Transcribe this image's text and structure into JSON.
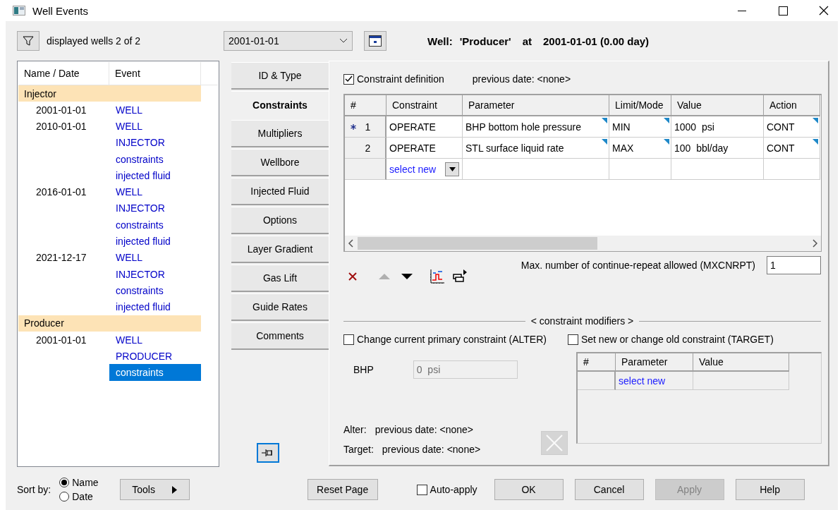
{
  "window": {
    "title": "Well Events"
  },
  "filter": {
    "label": "displayed wells 2 of 2"
  },
  "date_combo": {
    "value": "2001-01-01"
  },
  "well_header": {
    "label": "Well:",
    "name": "'Producer'",
    "at": "at",
    "date": "2001-01-01 (0.00 day)"
  },
  "tree": {
    "columns": [
      "Name / Date",
      "Event"
    ],
    "groups": [
      {
        "name": "Injector",
        "children": [
          {
            "date": "2001-01-01",
            "children": [
              {
                "event": "WELL",
                "selected": false
              }
            ]
          },
          {
            "date": "2010-01-01",
            "children": [
              {
                "event": "WELL",
                "selected": false
              },
              {
                "event": "INJECTOR",
                "selected": false
              },
              {
                "event": "constraints",
                "selected": false
              },
              {
                "event": "injected fluid",
                "selected": false
              }
            ]
          },
          {
            "date": "2016-01-01",
            "children": [
              {
                "event": "WELL",
                "selected": false
              },
              {
                "event": "INJECTOR",
                "selected": false
              },
              {
                "event": "constraints",
                "selected": false
              },
              {
                "event": "injected fluid",
                "selected": false
              }
            ]
          },
          {
            "date": "2021-12-17",
            "children": [
              {
                "event": "WELL",
                "selected": false
              },
              {
                "event": "INJECTOR",
                "selected": false
              },
              {
                "event": "constraints",
                "selected": false
              },
              {
                "event": "injected fluid",
                "selected": false
              }
            ]
          }
        ]
      },
      {
        "name": "Producer",
        "children": [
          {
            "date": "2001-01-01",
            "children": [
              {
                "event": "WELL",
                "selected": false
              },
              {
                "event": "PRODUCER",
                "selected": false
              },
              {
                "event": "constraints",
                "selected": true
              }
            ]
          }
        ]
      }
    ]
  },
  "tabs": [
    {
      "label": "ID & Type",
      "selected": false
    },
    {
      "label": "Constraints",
      "selected": true
    },
    {
      "label": "Multipliers",
      "selected": false
    },
    {
      "label": "Wellbore",
      "selected": false
    },
    {
      "label": "Injected Fluid",
      "selected": false
    },
    {
      "label": "Options",
      "selected": false
    },
    {
      "label": "Layer Gradient",
      "selected": false
    },
    {
      "label": "Gas Lift",
      "selected": false
    },
    {
      "label": "Guide Rates",
      "selected": false
    },
    {
      "label": "Comments",
      "selected": false
    }
  ],
  "constraints": {
    "definition": {
      "label": "Constraint definition",
      "checked": true
    },
    "previous_date": "previous date: <none>",
    "columns": [
      "#",
      "Constraint",
      "Parameter",
      "Limit/Mode",
      "Value",
      "Action"
    ],
    "rows": [
      {
        "current": true,
        "cells": [
          {
            "text": "1",
            "dropdown": false
          },
          {
            "text": "OPERATE",
            "dropdown": false
          },
          {
            "text": "BHP bottom hole pressure",
            "dropdown": true
          },
          {
            "text": "MIN",
            "dropdown": true
          },
          {
            "text": "1000  psi",
            "dropdown": false
          },
          {
            "text": "CONT",
            "dropdown": true
          }
        ]
      },
      {
        "current": false,
        "cells": [
          {
            "text": "2",
            "dropdown": false
          },
          {
            "text": "OPERATE",
            "dropdown": false
          },
          {
            "text": "STL surface liquid rate",
            "dropdown": true
          },
          {
            "text": "MAX",
            "dropdown": true
          },
          {
            "text": "100  bbl/day",
            "dropdown": false
          },
          {
            "text": "CONT",
            "dropdown": true
          }
        ]
      }
    ],
    "new_row": "select new",
    "toolbar": [
      {
        "kind": "delete",
        "disabled": false
      },
      {
        "kind": "up",
        "disabled": true
      },
      {
        "kind": "down",
        "disabled": false
      },
      {
        "kind": "chart",
        "disabled": false
      },
      {
        "kind": "copy",
        "disabled": false
      }
    ],
    "max_repeat": {
      "label": "Max. number of continue-repeat allowed (MXCNRPT)",
      "value": "1"
    }
  },
  "modifiers": {
    "title": "< constraint modifiers >",
    "alter": {
      "label": "Change current primary constraint (ALTER)",
      "checked": false
    },
    "target": {
      "label": "Set new or change old constraint (TARGET)",
      "checked": false
    },
    "bhp": {
      "label": "BHP",
      "value": "0  psi",
      "disabled": true
    },
    "target_table": {
      "columns": [
        "#",
        "Parameter",
        "Value"
      ],
      "new_row": "select new"
    },
    "notes": [
      {
        "label": "Alter:",
        "text": "previous date: <none>"
      },
      {
        "label": "Target:",
        "text": "previous date: <none>"
      }
    ],
    "clear_button": {
      "disabled": true
    }
  },
  "footer": {
    "sort_label": "Sort by:",
    "sort_options": [
      {
        "label": "Name",
        "selected": true
      },
      {
        "label": "Date",
        "selected": false
      }
    ],
    "tools": "Tools",
    "reset": "Reset Page",
    "auto_apply": {
      "label": "Auto-apply",
      "checked": false
    },
    "buttons": [
      {
        "label": "OK",
        "disabled": false
      },
      {
        "label": "Cancel",
        "disabled": false
      },
      {
        "label": "Apply",
        "disabled": true
      },
      {
        "label": "Help",
        "disabled": false
      }
    ]
  }
}
